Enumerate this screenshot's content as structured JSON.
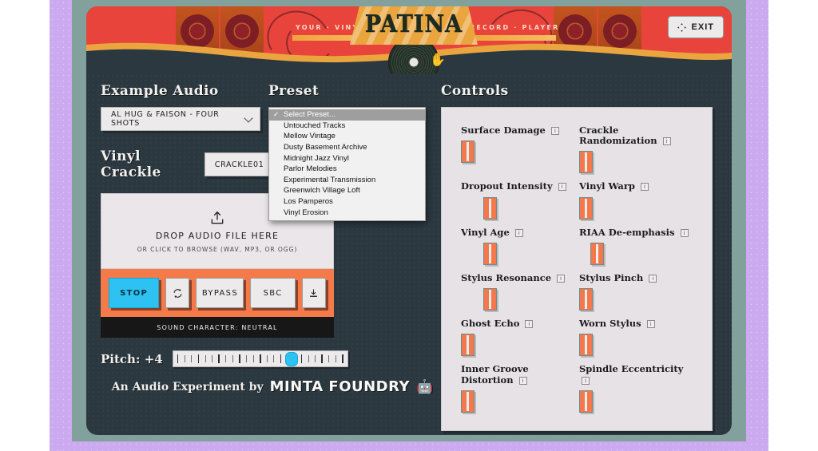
{
  "app": {
    "title": "PATINA",
    "tagline_left": "YOUR · VINYL",
    "tagline_right": "RECORD · PLAYER",
    "exit_label": "EXIT",
    "exit_icon": "fullscreen-exit-icon",
    "record_icon": "vinyl-record-icon",
    "hand_icon": "hand-icon"
  },
  "colors": {
    "banner_red": "#e8443c",
    "banner_orange": "#eaa53f",
    "surface_dark": "#2b3840",
    "frame_teal": "#82a19c",
    "page_lilac": "#ccaaf0",
    "accent_orange": "#f47a4a",
    "accent_cyan": "#2ec2f2",
    "panel_light": "#e6e2e6"
  },
  "example_audio": {
    "heading": "Example Audio",
    "selected": "AL HUG & FAISON - FOUR SHOTS",
    "chevron_icon": "chevron-down-icon"
  },
  "vinyl_crackle": {
    "heading": "Vinyl Crackle",
    "selected": "CRACKLE01",
    "chevron_icon": "chevron-down-icon"
  },
  "preset": {
    "heading": "Preset",
    "selected": "Select Preset...",
    "check_icon": "check-icon",
    "options": [
      "Select Preset...",
      "Untouched Tracks",
      "Mellow Vintage",
      "Dusty Basement Archive",
      "Midnight Jazz Vinyl",
      "Parlor Melodies",
      "Experimental Transmission",
      "Greenwich Village Loft",
      "Los Pamperos",
      "Vinyl Erosion"
    ]
  },
  "drop_zone": {
    "icon": "upload-icon",
    "title": "DROP AUDIO FILE HERE",
    "subtitle": "OR CLICK TO BROWSE (WAV, MP3, OR OGG)"
  },
  "transport": {
    "stop_label": "STOP",
    "loop_icon": "loop-icon",
    "bypass_label": "BYPASS",
    "sbc_label": "SBC",
    "download_icon": "download-icon",
    "status": "SOUND CHARACTER: NEUTRAL"
  },
  "pitch": {
    "label": "Pitch:",
    "value": "+4",
    "thumb_percent": 68,
    "tick_count": 25
  },
  "footer": {
    "credit": "An Audio Experiment by",
    "brand": "MINTA FOUNDRY",
    "brand_icon": "robot-icon"
  },
  "controls": {
    "heading": "Controls",
    "info_icon": "info-icon",
    "items": [
      {
        "label": "Surface Damage",
        "value": 50,
        "indent": 0
      },
      {
        "label": "Crackle Randomization",
        "value": 50,
        "indent": 1
      },
      {
        "label": "Dropout Intensity",
        "value": 50,
        "indent": 2
      },
      {
        "label": "Vinyl Warp",
        "value": 50,
        "indent": 1
      },
      {
        "label": "Vinyl Age",
        "value": 50,
        "indent": 2
      },
      {
        "label": "RIAA De-emphasis",
        "value": 50,
        "indent": 3
      },
      {
        "label": "Stylus Resonance",
        "value": 50,
        "indent": 2
      },
      {
        "label": "Stylus Pinch",
        "value": 50,
        "indent": 1
      },
      {
        "label": "Ghost Echo",
        "value": 50,
        "indent": 1
      },
      {
        "label": "Worn Stylus",
        "value": 50,
        "indent": 1
      },
      {
        "label": "Inner Groove Distortion",
        "value": 50,
        "indent": 0
      },
      {
        "label": "Spindle Eccentricity",
        "value": 50,
        "indent": 1
      }
    ]
  }
}
